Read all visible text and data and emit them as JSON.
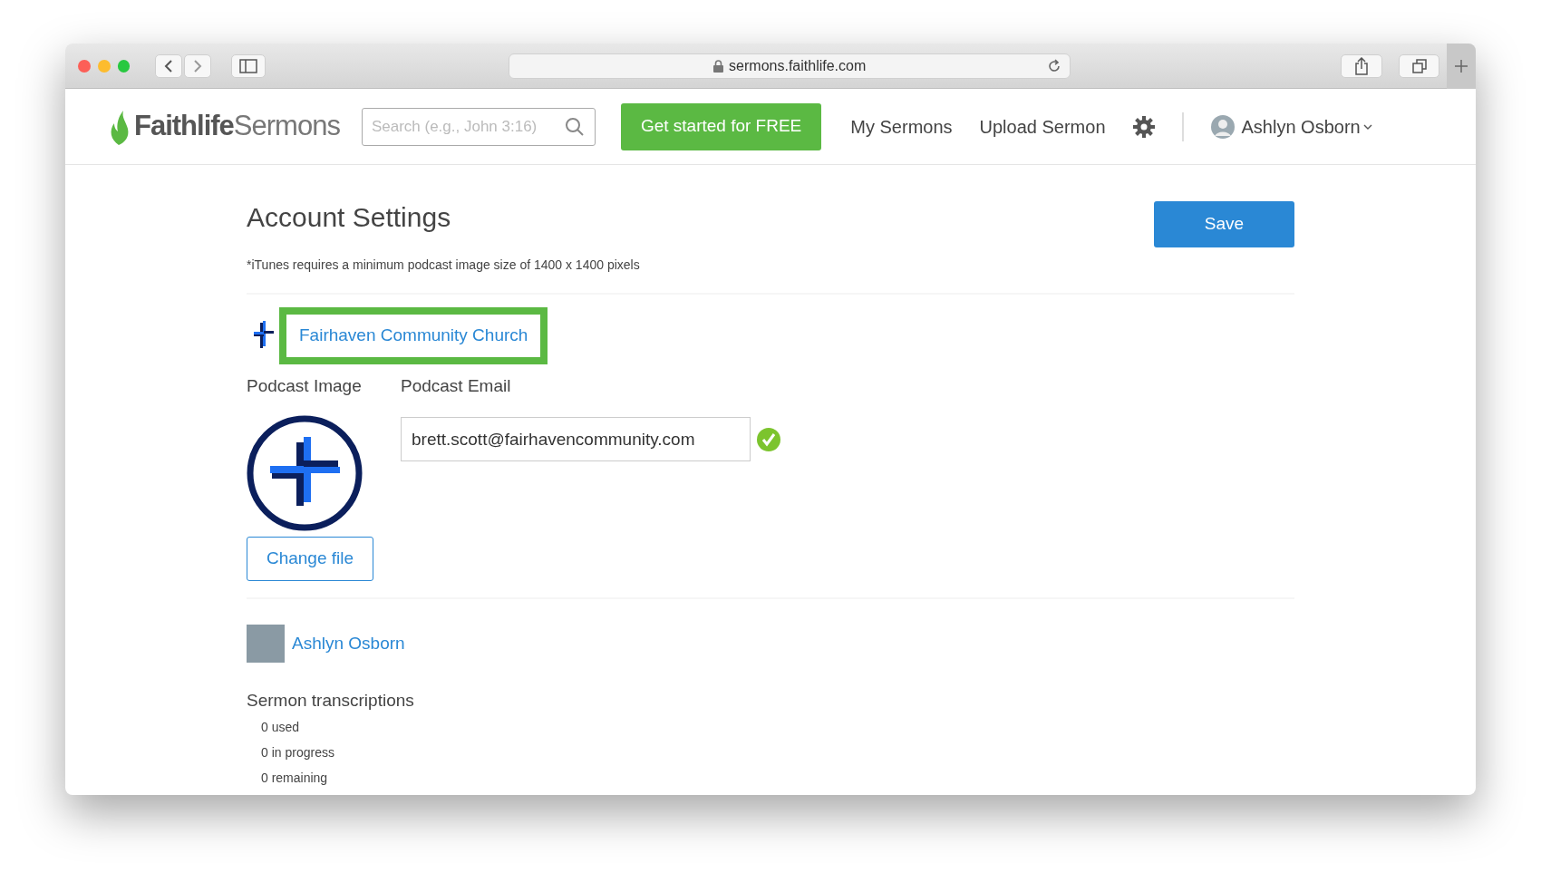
{
  "browser": {
    "url": "sermons.faithlife.com"
  },
  "navbar": {
    "brand": {
      "part1": "Faithlife",
      "part2": "Sermons"
    },
    "search": {
      "placeholder": "Search (e.g., John 3:16)"
    },
    "cta": "Get started for FREE",
    "links": [
      "My Sermons",
      "Upload Sermon"
    ],
    "user": "Ashlyn Osborn"
  },
  "page": {
    "title": "Account Settings",
    "save": "Save",
    "note": "*iTunes requires a minimum podcast image size of 1400 x 1400 pixels",
    "church": {
      "name": "Fairhaven Community Church",
      "highlighted": true
    },
    "podcast_image": {
      "label": "Podcast Image",
      "button": "Change file"
    },
    "podcast_email": {
      "label": "Podcast Email",
      "value": "brett.scott@fairhavencommunity.com",
      "valid": true
    },
    "user": {
      "name": "Ashlyn Osborn"
    },
    "transcriptions": {
      "title": "Sermon transcriptions",
      "items": [
        "0 used",
        "0 in progress",
        "0 remaining"
      ]
    }
  }
}
